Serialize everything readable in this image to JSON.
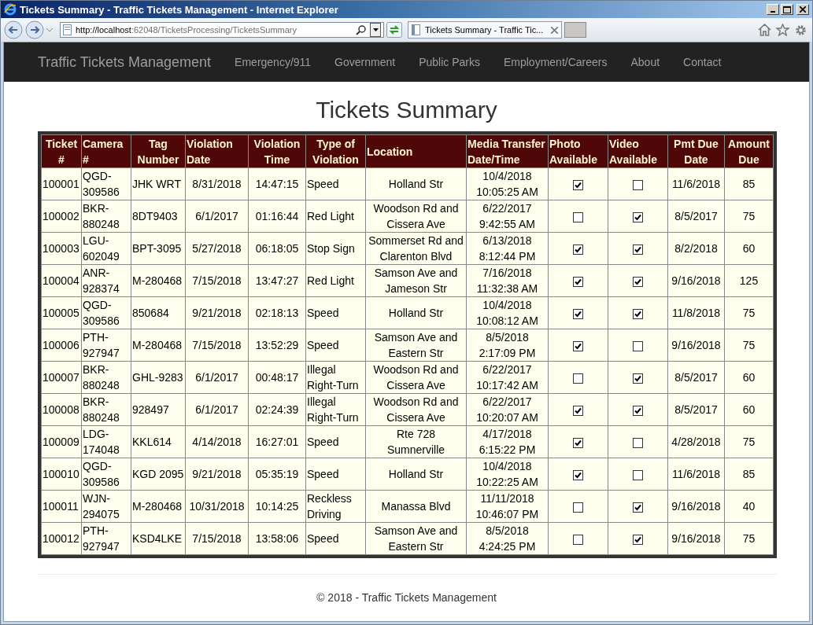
{
  "window": {
    "title": "Tickets Summary - Traffic Tickets Management - Internet Explorer"
  },
  "address_bar": {
    "url_host": "http://localhost",
    "url_rest": ":62048/TicketsProcessing/TicketsSummary"
  },
  "tabs": [
    {
      "label": "Tickets Summary - Traffic Tic...",
      "selected": true
    }
  ],
  "navbar": {
    "brand": "Traffic Tickets Management",
    "links": [
      "Emergency/911",
      "Government",
      "Public Parks",
      "Employment/Careers",
      "About",
      "Contact"
    ]
  },
  "heading": "Tickets Summary",
  "table": {
    "columns": [
      {
        "label": "Ticket #",
        "kind": "text"
      },
      {
        "label": "Camera #",
        "kind": "text"
      },
      {
        "label": "Tag Number",
        "kind": "text"
      },
      {
        "label": "Violation Date",
        "kind": "text"
      },
      {
        "label": "Violation Time",
        "kind": "text"
      },
      {
        "label": "Type of Violation",
        "kind": "text"
      },
      {
        "label": "Location",
        "kind": "text"
      },
      {
        "label": "Media Transfer Date/Time",
        "kind": "text"
      },
      {
        "label": "Photo Available",
        "kind": "check"
      },
      {
        "label": "Video Available",
        "kind": "check"
      },
      {
        "label": "Pmt Due Date",
        "kind": "text"
      },
      {
        "label": "Amount Due",
        "kind": "text"
      }
    ],
    "rows": [
      {
        "cells": [
          {
            "text": "100001"
          },
          {
            "text": "QGD-309586"
          },
          {
            "text": "JHK WRT"
          },
          {
            "text": "8/31/2018"
          },
          {
            "text": "14:47:15"
          },
          {
            "text": "Speed"
          },
          {
            "text": "Holland Str"
          },
          {
            "text": "10/4/2018 10:05:25 AM"
          },
          {
            "checked": true
          },
          {
            "checked": false
          },
          {
            "text": "11/6/2018"
          },
          {
            "text": "85"
          }
        ]
      },
      {
        "cells": [
          {
            "text": "100002"
          },
          {
            "text": "BKR-880248"
          },
          {
            "text": "8DT9403"
          },
          {
            "text": "6/1/2017"
          },
          {
            "text": "01:16:44"
          },
          {
            "text": "Red Light"
          },
          {
            "text": "Woodson Rd and Cissera Ave"
          },
          {
            "text": "6/22/2017 9:42:55 AM"
          },
          {
            "checked": false
          },
          {
            "checked": true
          },
          {
            "text": "8/5/2017"
          },
          {
            "text": "75"
          }
        ]
      },
      {
        "cells": [
          {
            "text": "100003"
          },
          {
            "text": "LGU-602049"
          },
          {
            "text": "BPT-3095"
          },
          {
            "text": "5/27/2018"
          },
          {
            "text": "06:18:05"
          },
          {
            "text": "Stop Sign"
          },
          {
            "text": "Sommerset Rd and Clarenton Blvd"
          },
          {
            "text": "6/13/2018 8:12:44 PM"
          },
          {
            "checked": true
          },
          {
            "checked": true
          },
          {
            "text": "8/2/2018"
          },
          {
            "text": "60"
          }
        ]
      },
      {
        "cells": [
          {
            "text": "100004"
          },
          {
            "text": "ANR-928374"
          },
          {
            "text": "M-280468"
          },
          {
            "text": "7/15/2018"
          },
          {
            "text": "13:47:27"
          },
          {
            "text": "Red Light"
          },
          {
            "text": "Samson Ave and Jameson Str"
          },
          {
            "text": "7/16/2018 11:32:38 AM"
          },
          {
            "checked": true
          },
          {
            "checked": true
          },
          {
            "text": "9/16/2018"
          },
          {
            "text": "125"
          }
        ]
      },
      {
        "cells": [
          {
            "text": "100005"
          },
          {
            "text": "QGD-309586"
          },
          {
            "text": "850684"
          },
          {
            "text": "9/21/2018"
          },
          {
            "text": "02:18:13"
          },
          {
            "text": "Speed"
          },
          {
            "text": "Holland Str"
          },
          {
            "text": "10/4/2018 10:08:12 AM"
          },
          {
            "checked": true
          },
          {
            "checked": true
          },
          {
            "text": "11/8/2018"
          },
          {
            "text": "75"
          }
        ]
      },
      {
        "cells": [
          {
            "text": "100006"
          },
          {
            "text": "PTH-927947"
          },
          {
            "text": "M-280468"
          },
          {
            "text": "7/15/2018"
          },
          {
            "text": "13:52:29"
          },
          {
            "text": "Speed"
          },
          {
            "text": "Samson Ave and Eastern Str"
          },
          {
            "text": "8/5/2018 2:17:09 PM"
          },
          {
            "checked": true
          },
          {
            "checked": false
          },
          {
            "text": "9/16/2018"
          },
          {
            "text": "75"
          }
        ]
      },
      {
        "cells": [
          {
            "text": "100007"
          },
          {
            "text": "BKR-880248"
          },
          {
            "text": "GHL-9283"
          },
          {
            "text": "6/1/2017"
          },
          {
            "text": "00:48:17"
          },
          {
            "text": "Illegal Right-Turn"
          },
          {
            "text": "Woodson Rd and Cissera Ave"
          },
          {
            "text": "6/22/2017 10:17:42 AM"
          },
          {
            "checked": false
          },
          {
            "checked": true
          },
          {
            "text": "8/5/2017"
          },
          {
            "text": "60"
          }
        ]
      },
      {
        "cells": [
          {
            "text": "100008"
          },
          {
            "text": "BKR-880248"
          },
          {
            "text": "928497"
          },
          {
            "text": "6/1/2017"
          },
          {
            "text": "02:24:39"
          },
          {
            "text": "Illegal Right-Turn"
          },
          {
            "text": "Woodson Rd and Cissera Ave"
          },
          {
            "text": "6/22/2017 10:20:07 AM"
          },
          {
            "checked": true
          },
          {
            "checked": true
          },
          {
            "text": "8/5/2017"
          },
          {
            "text": "60"
          }
        ]
      },
      {
        "cells": [
          {
            "text": "100009"
          },
          {
            "text": "LDG-174048"
          },
          {
            "text": "KKL614"
          },
          {
            "text": "4/14/2018"
          },
          {
            "text": "16:27:01"
          },
          {
            "text": "Speed"
          },
          {
            "text": "Rte 728 Sumnerville"
          },
          {
            "text": "4/17/2018 6:15:22 PM"
          },
          {
            "checked": true
          },
          {
            "checked": false
          },
          {
            "text": "4/28/2018"
          },
          {
            "text": "75"
          }
        ]
      },
      {
        "cells": [
          {
            "text": "100010"
          },
          {
            "text": "QGD-309586"
          },
          {
            "text": "KGD 2095"
          },
          {
            "text": "9/21/2018"
          },
          {
            "text": "05:35:19"
          },
          {
            "text": "Speed"
          },
          {
            "text": "Holland Str"
          },
          {
            "text": "10/4/2018 10:22:25 AM"
          },
          {
            "checked": true
          },
          {
            "checked": false
          },
          {
            "text": "11/6/2018"
          },
          {
            "text": "85"
          }
        ]
      },
      {
        "cells": [
          {
            "text": "100011"
          },
          {
            "text": "WJN-294075"
          },
          {
            "text": "M-280468"
          },
          {
            "text": "10/31/2018"
          },
          {
            "text": "10:14:25"
          },
          {
            "text": "Reckless Driving"
          },
          {
            "text": "Manassa Blvd"
          },
          {
            "text": "11/11/2018 10:46:07 PM"
          },
          {
            "checked": false
          },
          {
            "checked": true
          },
          {
            "text": "9/16/2018"
          },
          {
            "text": "40"
          }
        ]
      },
      {
        "cells": [
          {
            "text": "100012"
          },
          {
            "text": "PTH-927947"
          },
          {
            "text": "KSD4LKE"
          },
          {
            "text": "7/15/2018"
          },
          {
            "text": "13:58:06"
          },
          {
            "text": "Speed"
          },
          {
            "text": "Samson Ave and Eastern Str"
          },
          {
            "text": "8/5/2018 4:24:25 PM"
          },
          {
            "checked": false
          },
          {
            "checked": true
          },
          {
            "text": "9/16/2018"
          },
          {
            "text": "75"
          }
        ]
      }
    ]
  },
  "footer": "© 2018 - Traffic Tickets Management"
}
